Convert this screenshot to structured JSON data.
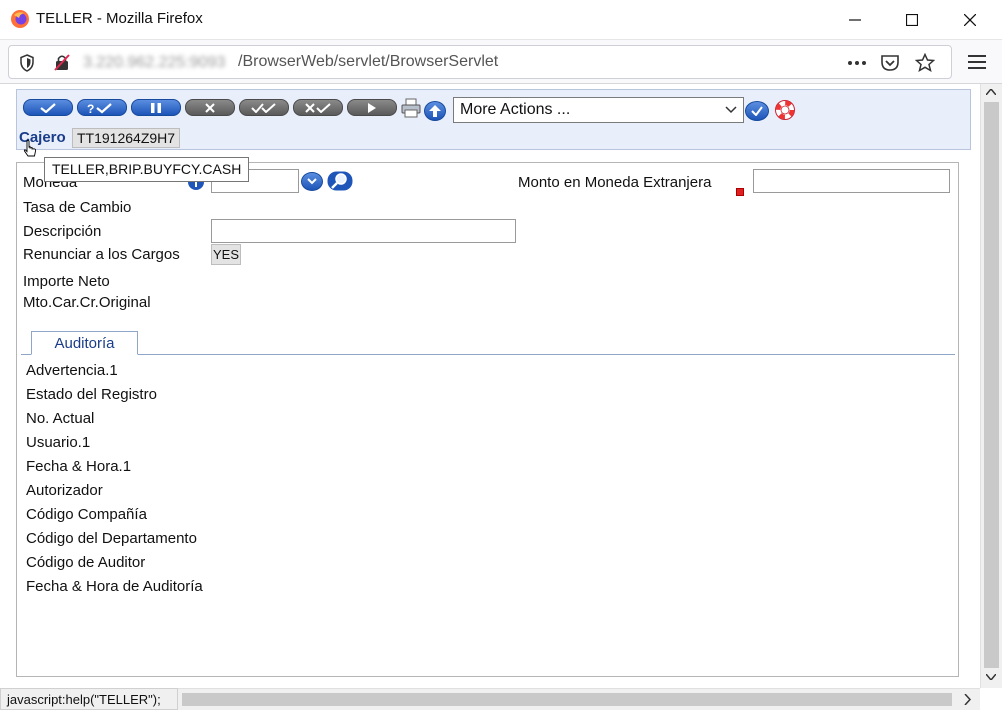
{
  "window": {
    "title": "TELLER - Mozilla Firefox",
    "minimize": "—",
    "maximize": "☐",
    "close": "✕"
  },
  "nav": {
    "url_host": "3.220.962.225:9093",
    "url_path": "/BrowserWeb/servlet/BrowserServlet"
  },
  "toolbar": {
    "buttons": [
      "commit",
      "validate",
      "hold",
      "delete",
      "authorise",
      "reverse",
      "next"
    ],
    "actions_select": "More Actions ...",
    "cajero_label": "Cajero",
    "cajero_value": "TT191264Z9H7"
  },
  "tooltip": "TELLER,BRIP.BUYFCY.CASH",
  "form": {
    "moneda_label": "Moneda",
    "monto_label": "Monto en Moneda Extranjera",
    "tasa_label": "Tasa de Cambio",
    "descripcion_label": "Descripción",
    "renunciar_label": "Renunciar a los Cargos",
    "renunciar_value": "YES",
    "importe_label": "Importe Neto",
    "mto_label": "Mto.Car.Cr.Original",
    "moneda_value": "",
    "monto_value": "",
    "descripcion_value": ""
  },
  "tab": {
    "label": "Auditoría"
  },
  "audit_fields": [
    "Advertencia.1",
    "Estado del Registro",
    "No. Actual",
    "Usuario.1",
    "Fecha & Hora.1",
    "Autorizador",
    "Código Compañía",
    "Código del Departamento",
    "Código de Auditor",
    "Fecha & Hora de Auditoría"
  ],
  "status": "javascript:help(\"TELLER\");",
  "colors": {
    "accent": "#1a3d8a",
    "button_blue": "#1d55b8",
    "button_gray": "#5a5a5a",
    "panel_bg": "#e9eefb",
    "required": "#e02020"
  }
}
